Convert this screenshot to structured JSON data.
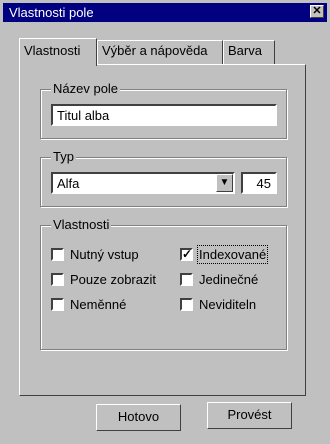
{
  "window": {
    "title": "Vlastnosti pole",
    "close_glyph": "✕"
  },
  "tabs": [
    {
      "label": "Vlastnosti"
    },
    {
      "label": "Výběr a nápověda"
    },
    {
      "label": "Barva"
    }
  ],
  "name_group": {
    "legend": "Název pole",
    "value": "Titul alba"
  },
  "type_group": {
    "legend": "Typ",
    "selected": "Alfa",
    "length": "45"
  },
  "props_group": {
    "legend": "Vlastnosti",
    "items": [
      {
        "label": "Nutný vstup",
        "checked": false
      },
      {
        "label": "Indexované",
        "checked": true
      },
      {
        "label": "Pouze zobrazit",
        "checked": false
      },
      {
        "label": "Jedinečné",
        "checked": false
      },
      {
        "label": "Neměnné",
        "checked": false
      },
      {
        "label": "Neviditeln",
        "checked": false
      }
    ]
  },
  "buttons": {
    "ok": "Hotovo",
    "apply": "Provést"
  }
}
